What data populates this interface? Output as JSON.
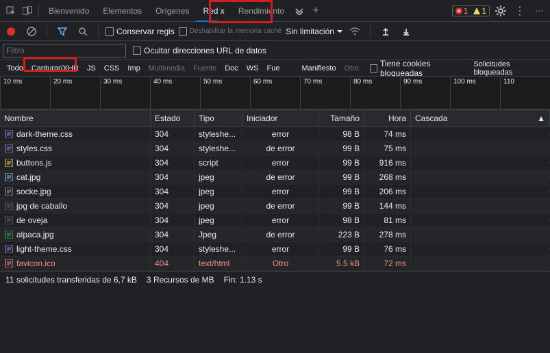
{
  "top": {
    "tabs": [
      "Bienvenido",
      "Elementos",
      "Orígenes",
      "Red x",
      "Rendimiento"
    ],
    "active_index": 3,
    "errors": "1",
    "warnings": "1"
  },
  "toolbar": {
    "preserve_log": "Conservar regis",
    "disable_cache": "Deshabilitar la memoria caché",
    "throttle": "Sin limitación"
  },
  "filter": {
    "placeholder": "Filtro",
    "hide_data_urls": "Ocultar direcciones URL de datos"
  },
  "types": {
    "all": "Todo",
    "xhr": "Capturar/XHR",
    "js": "JS",
    "css": "CSS",
    "img": "Imp",
    "media": "Multimedia",
    "font": "Fuente",
    "doc": "Doc",
    "ws": "WS",
    "fue": "Fue",
    "manifest": "Manifiesto",
    "other": "Otro",
    "blocked_cookies": "Tiene cookies bloqueadas",
    "blocked_requests": "Solicitudes bloqueadas"
  },
  "timeline_ticks": [
    "10 ms",
    "20 ms",
    "30 ms",
    "40 ms",
    "50 ms",
    "60 ms",
    "70 ms",
    "80 ms",
    "90 ms",
    "100 ms",
    "110"
  ],
  "headers": {
    "nombre": "Nombre",
    "estado": "Estado",
    "tipo": "Tipo",
    "iniciador": "Iniciador",
    "tamano": "Tamaño",
    "hora": "Hora",
    "cascada": "Cascada"
  },
  "rows": [
    {
      "name": "dark-theme.css",
      "icon": "#a27be0",
      "status": "304",
      "type": "styleshe...",
      "initiator": "error",
      "size": "98 B",
      "time": "74 ms",
      "bar": [
        0,
        4
      ]
    },
    {
      "name": "styles.css",
      "icon": "#a27be0",
      "status": "304",
      "type": "styleshe...",
      "initiator": "de error",
      "size": "99 B",
      "time": "75 ms",
      "bar": [
        0,
        4
      ]
    },
    {
      "name": "buttons.js",
      "icon": "#fdd663",
      "status": "304",
      "type": "script",
      "initiator": "error",
      "size": "99 B",
      "time": "916 ms",
      "bar": [
        0,
        100
      ]
    },
    {
      "name": "cat.jpg",
      "icon": "#8ab4f8",
      "status": "304",
      "type": "jpeg",
      "initiator": "de error",
      "size": "99 B",
      "time": "268 ms",
      "bar": [
        0,
        22
      ]
    },
    {
      "name": "socke.jpg",
      "icon": "#9aa0a6",
      "status": "304",
      "type": "jpeg",
      "initiator": "error",
      "size": "99 B",
      "time": "206 ms",
      "bar": [
        0,
        16
      ]
    },
    {
      "name": "jpg de caballo",
      "icon": "#5f6368",
      "status": "304",
      "type": "jpeg",
      "initiator": "de error",
      "size": "99 B",
      "time": "144 ms",
      "bar": [
        0,
        12
      ]
    },
    {
      "name": " de oveja",
      "icon": "#5f6368",
      "status": "304",
      "type": "jpeg",
      "initiator": "error",
      "size": "98 B",
      "time": "81 ms",
      "bar": [
        0,
        5
      ]
    },
    {
      "name": "alpaca.jpg",
      "icon": "#34a853",
      "status": "304",
      "type": "Jpeg",
      "initiator": "de error",
      "size": "223 B",
      "time": "278 ms",
      "bar": [
        0,
        24
      ]
    },
    {
      "name": "light-theme.css",
      "icon": "#a27be0",
      "status": "304",
      "type": "styleshe...",
      "initiator": "error",
      "size": "99 B",
      "time": "76 ms",
      "bar": [
        0,
        4
      ]
    },
    {
      "name": "favicon.ico",
      "icon": "#f28b82",
      "status": "404",
      "type": "text/html",
      "initiator": "Otro",
      "size": "5.5 kB",
      "time": "72 ms",
      "bar": [
        96,
        3
      ],
      "err": true
    }
  ],
  "footer": {
    "requests": "11",
    "transferred": "solicitudes transferidas de 6,7 kB",
    "resources": "Recursos de MB",
    "res_num": "3",
    "finish": "Fin: 1.13 s"
  }
}
